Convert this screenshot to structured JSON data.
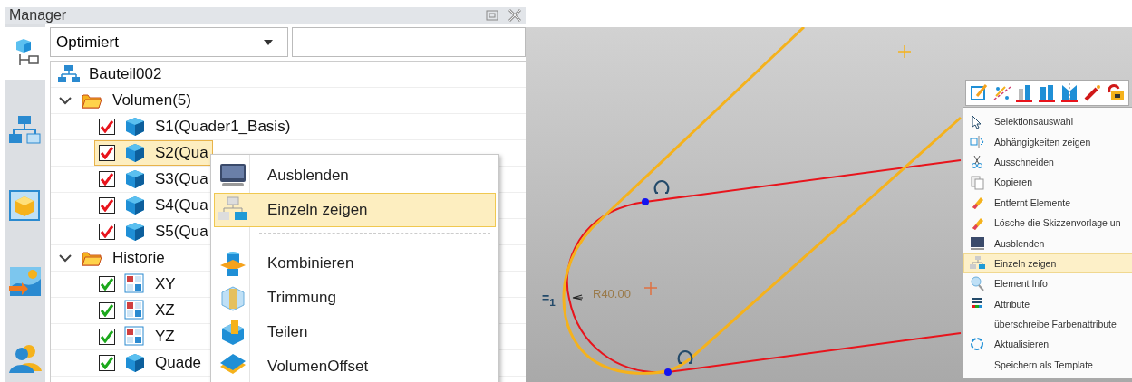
{
  "manager": {
    "title": "Manager",
    "side_tabs": [
      {
        "selected": true
      },
      {
        "selected": false
      },
      {
        "selected": false
      },
      {
        "selected": false
      },
      {
        "selected": false
      }
    ],
    "filter": {
      "value": "Optimiert"
    },
    "tree": [
      {
        "label": "Bauteil002",
        "kind": "part"
      },
      {
        "label": "Volumen(5)",
        "kind": "folder",
        "expanded": true,
        "children": [
          {
            "label": "S1(Quader1_Basis)",
            "kind": "solid",
            "checked": true,
            "color": "#e8141c",
            "selected": false
          },
          {
            "label": "S2(Qua",
            "kind": "solid",
            "checked": true,
            "color": "#e8141c",
            "selected": true
          },
          {
            "label": "S3(Qua",
            "kind": "solid",
            "checked": true,
            "color": "#e8141c",
            "selected": false
          },
          {
            "label": "S4(Qua",
            "kind": "solid",
            "checked": true,
            "color": "#e8141c",
            "selected": false
          },
          {
            "label": "S5(Qua",
            "kind": "solid",
            "checked": true,
            "color": "#e8141c",
            "selected": false
          }
        ]
      },
      {
        "label": "Historie",
        "kind": "folder",
        "expanded": true,
        "children": [
          {
            "label": "XY",
            "kind": "plane",
            "checked": true,
            "color": "#1ca81c",
            "selected": false
          },
          {
            "label": "XZ",
            "kind": "plane",
            "checked": true,
            "color": "#1ca81c",
            "selected": false
          },
          {
            "label": "YZ",
            "kind": "plane",
            "checked": true,
            "color": "#1ca81c",
            "selected": false
          },
          {
            "label": "Quade",
            "kind": "solid",
            "checked": true,
            "color": "#1ca81c",
            "selected": false
          }
        ]
      }
    ],
    "context_menu": [
      {
        "kind": "item",
        "label": "Ausblenden",
        "selected": false
      },
      {
        "kind": "item",
        "label": "Einzeln zeigen",
        "selected": true
      },
      {
        "kind": "separator"
      },
      {
        "kind": "item",
        "label": "Kombinieren",
        "selected": false
      },
      {
        "kind": "item",
        "label": "Trimmung",
        "selected": false
      },
      {
        "kind": "item",
        "label": "Teilen",
        "selected": false
      },
      {
        "kind": "item",
        "label": "VolumenOffset",
        "selected": false
      }
    ]
  },
  "sketch": {
    "radius_label": "R40.00",
    "equal_label": "=$_{1}$",
    "context_menu": [
      {
        "label": "Selektionsauswahl",
        "selected": false
      },
      {
        "label": "Abhängigkeiten zeigen",
        "selected": false
      },
      {
        "label": "Ausschneiden",
        "selected": false
      },
      {
        "label": "Kopieren",
        "selected": false
      },
      {
        "label": "Entfernt Elemente",
        "selected": false
      },
      {
        "label": "Lösche die Skizzenvorlage un",
        "selected": false
      },
      {
        "label": "Ausblenden",
        "selected": false
      },
      {
        "label": "Einzeln zeigen",
        "selected": true
      },
      {
        "label": "Element Info",
        "selected": false
      },
      {
        "label": "Attribute",
        "selected": false
      },
      {
        "label": "überschreibe Farbenattribute",
        "selected": false
      },
      {
        "label": "Aktualisieren",
        "selected": false
      },
      {
        "label": "Speichern als Template",
        "selected": false
      }
    ]
  }
}
